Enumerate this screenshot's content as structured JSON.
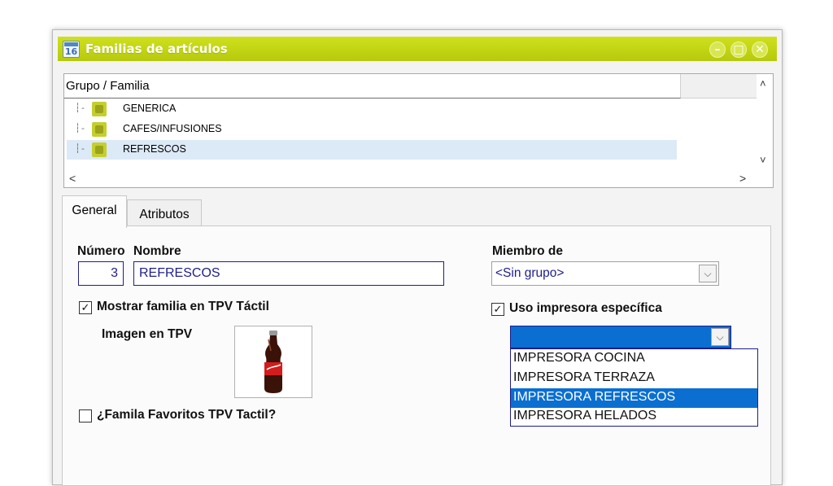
{
  "window": {
    "title": "Familias de artículos",
    "app_icon_text": "16",
    "accent_color": "#c2d414",
    "buttons": {
      "minimize": "–",
      "restore": "□",
      "close": "✕"
    }
  },
  "tree": {
    "header": "Grupo / Familia",
    "connector": "┆- ",
    "items": [
      {
        "label": "GENERICA",
        "selected": false
      },
      {
        "label": "CAFES/INFUSIONES",
        "selected": false
      },
      {
        "label": "REFRESCOS",
        "selected": true
      }
    ],
    "scroll": {
      "up": "˄",
      "down": "˅",
      "left": "<",
      "right": ">"
    }
  },
  "tabs": [
    {
      "label": "General",
      "active": true
    },
    {
      "label": "Atributos",
      "active": false
    }
  ],
  "general": {
    "numero_label": "Número",
    "nombre_label": "Nombre",
    "numero_value": "3",
    "nombre_value": "REFRESCOS",
    "miembro_label": "Miembro de",
    "miembro_value": "<Sin grupo>",
    "mostrar_label": "Mostrar familia en TPV Táctil",
    "mostrar_checked": true,
    "imagen_label": "Imagen en TPV",
    "imagen_icon": "soda-bottle-icon",
    "favoritos_label": "¿Famila Favoritos TPV Tactil?",
    "favoritos_checked": false,
    "impresora_label": "Uso impresora específica",
    "impresora_checked": true,
    "impresora_value": "",
    "check_mark": "✓",
    "dropdown_arrow": "⌵"
  },
  "printer_options": [
    {
      "label": "IMPRESORA COCINA",
      "selected": false
    },
    {
      "label": "IMPRESORA TERRAZA",
      "selected": false
    },
    {
      "label": "IMPRESORA REFRESCOS",
      "selected": true
    },
    {
      "label": "IMPRESORA HELADOS",
      "selected": false
    }
  ]
}
